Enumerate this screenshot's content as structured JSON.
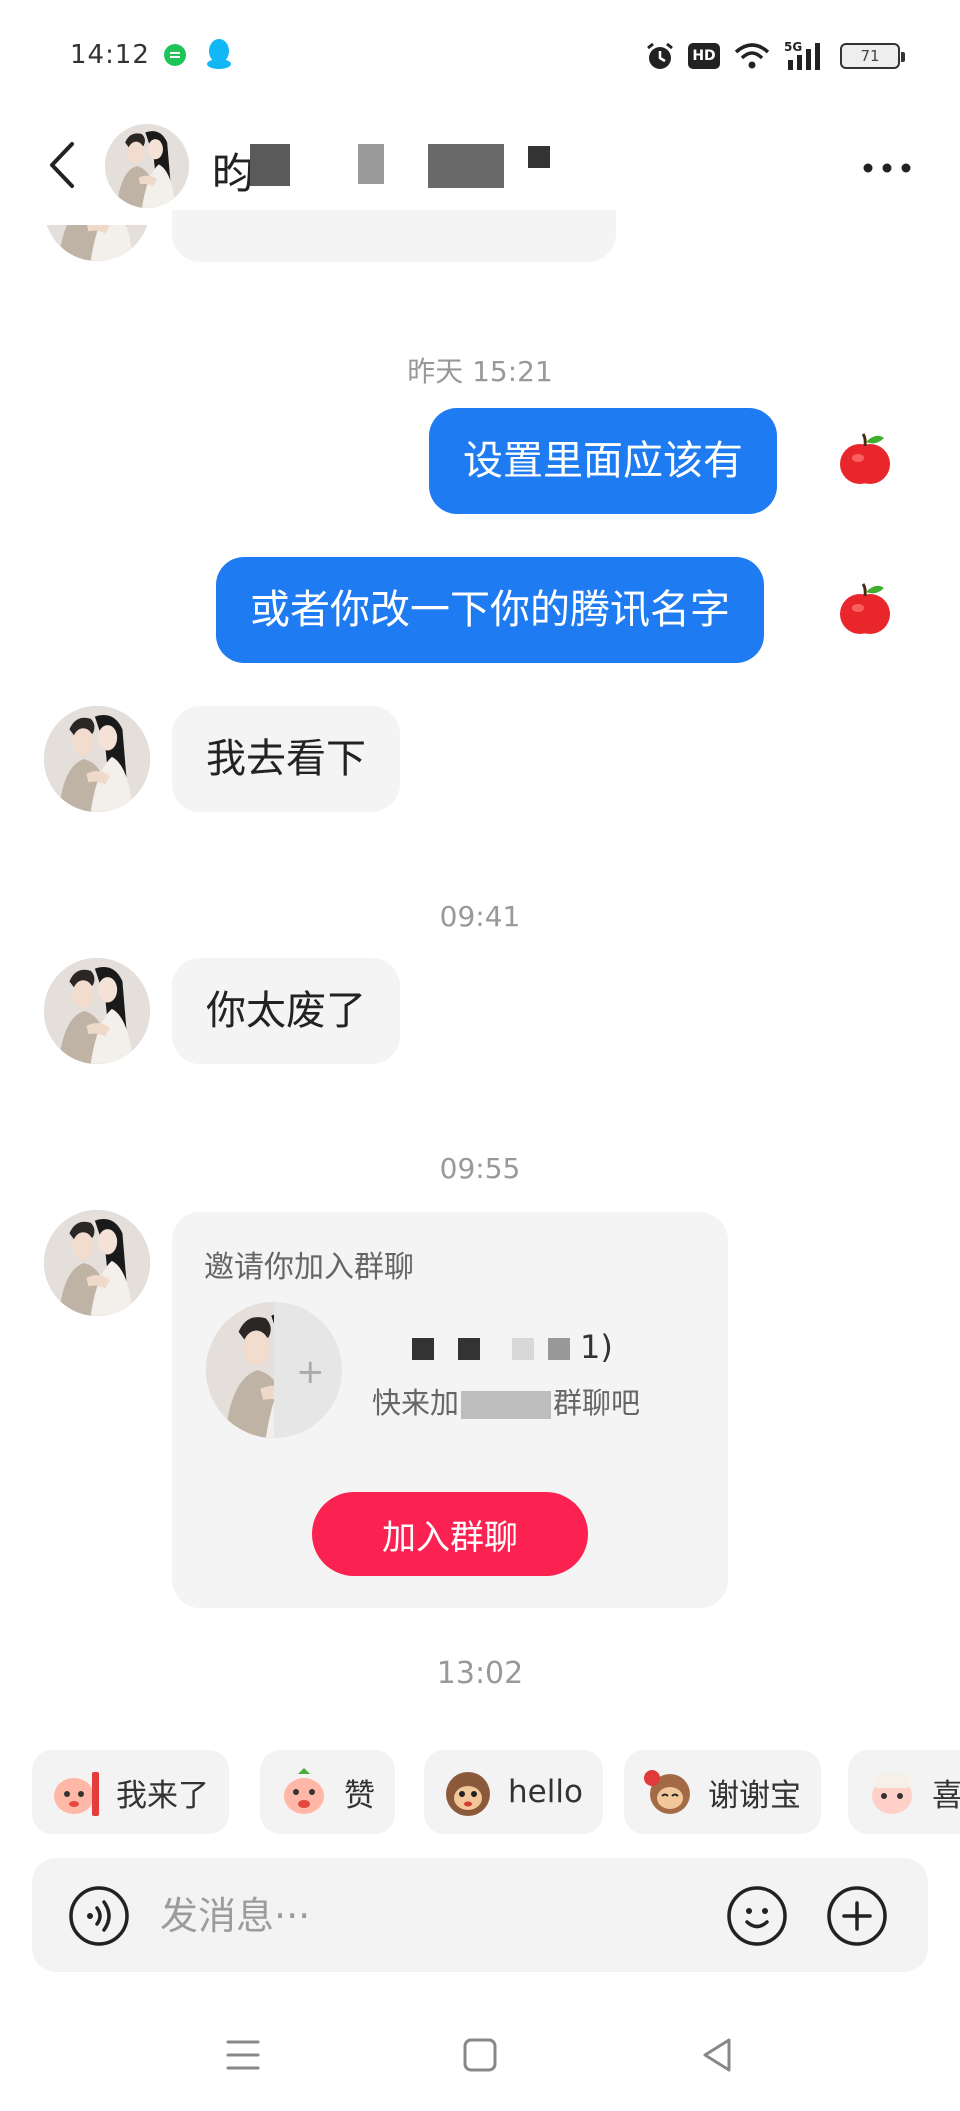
{
  "status_bar": {
    "time": "14:12",
    "network": "5G",
    "battery": "71"
  },
  "header": {
    "contact_name": "昀"
  },
  "messages": [
    {
      "type": "timestamp",
      "text": "昨天 15:21"
    },
    {
      "type": "sent",
      "text": "设置里面应该有"
    },
    {
      "type": "sent",
      "text": "或者你改一下你的腾讯名字"
    },
    {
      "type": "received",
      "text": "我去看下"
    },
    {
      "type": "timestamp",
      "text": "09:41"
    },
    {
      "type": "received",
      "text": "你太废了"
    },
    {
      "type": "timestamp",
      "text": "09:55"
    },
    {
      "type": "timestamp",
      "text": "13:02"
    }
  ],
  "invite_card": {
    "title": "邀请你加入群聊",
    "group_name_suffix": "1)",
    "subtitle_prefix": "快来加",
    "subtitle_suffix": "群聊吧",
    "join_label": "加入群聊"
  },
  "quick_replies": [
    {
      "label": "我来了",
      "icon": "arrive-emoji"
    },
    {
      "label": "赞",
      "icon": "thumb-emoji"
    },
    {
      "label": "hello",
      "icon": "monkey-emoji"
    },
    {
      "label": "谢谢宝",
      "icon": "thanks-emoji"
    },
    {
      "label": "喜",
      "icon": "happy-emoji"
    }
  ],
  "input": {
    "placeholder": "发消息···"
  },
  "colors": {
    "sent_bubble": "#1e7bf2",
    "received_bubble": "#f4f4f4",
    "join_button": "#fb2150",
    "timestamp": "#999999"
  }
}
